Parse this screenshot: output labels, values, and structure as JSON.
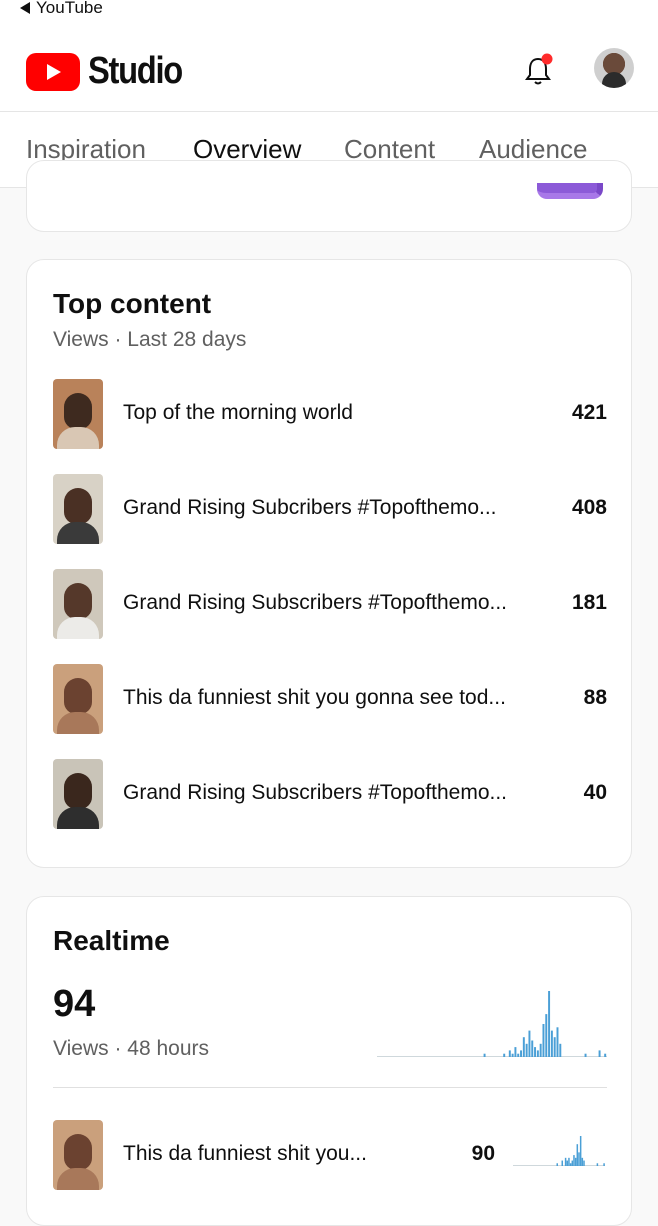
{
  "status_bar": {
    "back_label": "YouTube"
  },
  "header": {
    "logo_text": "Studio",
    "notification_dot_color": "#ff2b2b"
  },
  "tabs": [
    {
      "label": "Inspiration",
      "active": false
    },
    {
      "label": "Overview",
      "active": true
    },
    {
      "label": "Content",
      "active": false
    },
    {
      "label": "Audience",
      "active": false
    }
  ],
  "top_content": {
    "title": "Top content",
    "subtitle": "Views · Last 28 days",
    "items": [
      {
        "title": "Top of the morning world",
        "views": "421"
      },
      {
        "title": "Grand Rising Subcribers #Topofthemo...",
        "views": "408"
      },
      {
        "title": "Grand Rising Subscribers #Topofthemo...",
        "views": "181"
      },
      {
        "title": "This da funniest shit you gonna see tod...",
        "views": "88"
      },
      {
        "title": "Grand Rising Subscribers #Topofthemo...",
        "views": "40"
      }
    ]
  },
  "realtime": {
    "title": "Realtime",
    "views": "94",
    "subtitle": "Views · 48 hours",
    "bar_color": "#4a9fd6",
    "sparkline": [
      0,
      0,
      0,
      0,
      0,
      0,
      0,
      0,
      0,
      0,
      0,
      0,
      0,
      0,
      0,
      0,
      0,
      0,
      0,
      0,
      0,
      0,
      0,
      0,
      0,
      0,
      0,
      0,
      0,
      0,
      0,
      0,
      0,
      0,
      0,
      0,
      0,
      0,
      1,
      0,
      0,
      0,
      0,
      0,
      0,
      1,
      0,
      2,
      1,
      3,
      1,
      2,
      6,
      4,
      8,
      5,
      3,
      2,
      4,
      10,
      13,
      20,
      8,
      6,
      9,
      4,
      0,
      0,
      0,
      0,
      0,
      0,
      0,
      0,
      1,
      0,
      0,
      0,
      0,
      2,
      0,
      1
    ],
    "top_item": {
      "title": "This da funniest shit you...",
      "views": "90",
      "sparkline": [
        0,
        0,
        0,
        0,
        0,
        0,
        0,
        0,
        0,
        0,
        0,
        0,
        0,
        0,
        0,
        0,
        0,
        0,
        0,
        0,
        0,
        0,
        0,
        0,
        0,
        0,
        1,
        0,
        0,
        2,
        0,
        3,
        2,
        3,
        1,
        2,
        4,
        3,
        8,
        5,
        11,
        3,
        2,
        0,
        0,
        0,
        0,
        0,
        0,
        0,
        1,
        0,
        0,
        0,
        1
      ]
    }
  }
}
